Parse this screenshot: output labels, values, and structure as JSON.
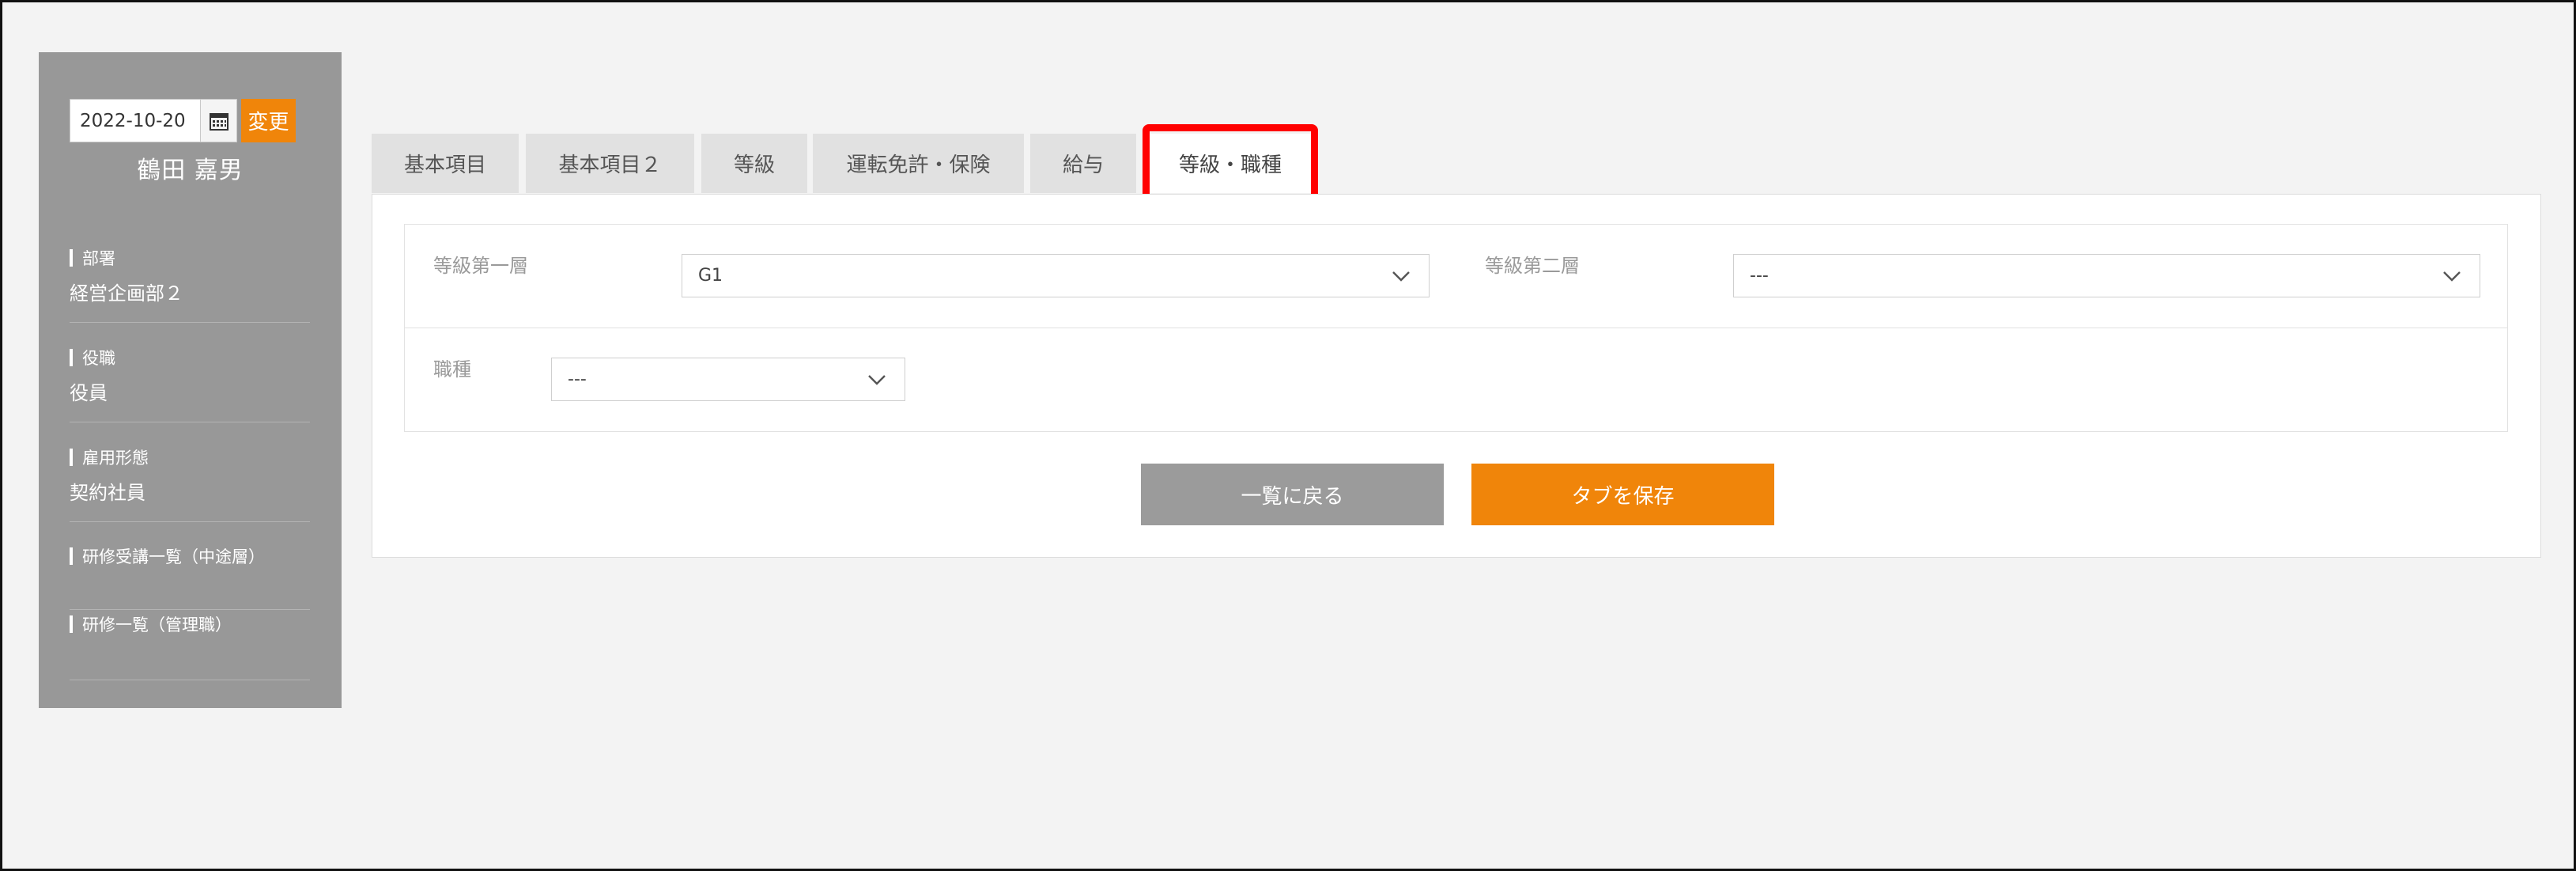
{
  "sidebar": {
    "date_value": "2022-10-20",
    "calendar_icon": "calendar-icon",
    "change_label": "変更",
    "user_name": "鶴田 嘉男",
    "sections": [
      {
        "label": "部署",
        "value": "経営企画部２"
      },
      {
        "label": "役職",
        "value": "役員"
      },
      {
        "label": "雇用形態",
        "value": "契約社員"
      }
    ],
    "links": [
      {
        "label": "研修受講一覧（中途層）"
      },
      {
        "label": "研修一覧（管理職）"
      }
    ]
  },
  "tabs": [
    {
      "label": "基本項目"
    },
    {
      "label": "基本項目２"
    },
    {
      "label": "等級"
    },
    {
      "label": "運転免許・保険"
    },
    {
      "label": "給与"
    },
    {
      "label": "等級・職種",
      "active": true
    }
  ],
  "form": {
    "grade1_label": "等級第一層",
    "grade1_value": "G1",
    "grade2_label": "等級第二層",
    "grade2_value": "---",
    "job_label": "職種",
    "job_value": "---"
  },
  "buttons": {
    "back_label": "一覧に戻る",
    "save_label": "タブを保存"
  },
  "colors": {
    "accent": "#f0850a",
    "sidebar_bg": "#989898",
    "highlight": "#ff0000"
  }
}
